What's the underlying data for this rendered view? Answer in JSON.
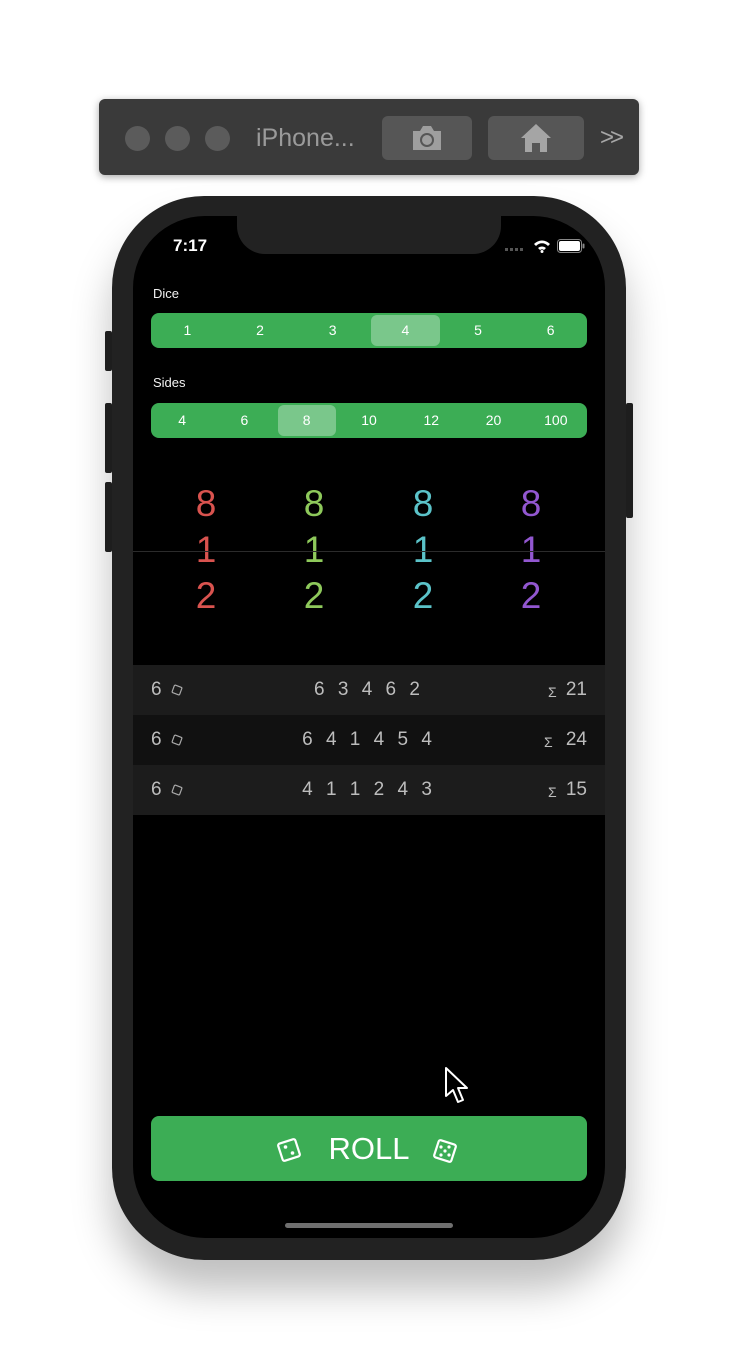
{
  "simulator": {
    "title": "iPhone...",
    "more_glyph": ">>"
  },
  "status_bar": {
    "time": "7:17"
  },
  "dice_picker": {
    "label": "Dice",
    "options": [
      "1",
      "2",
      "3",
      "4",
      "5",
      "6"
    ],
    "selected": "4"
  },
  "sides_picker": {
    "label": "Sides",
    "options": [
      "4",
      "6",
      "8",
      "10",
      "12",
      "20",
      "100"
    ],
    "selected": "8"
  },
  "dice_wheels": [
    {
      "above": "8",
      "current": "1",
      "below": "2",
      "color": "#d9534f"
    },
    {
      "above": "8",
      "current": "1",
      "below": "2",
      "color": "#8ec95b"
    },
    {
      "above": "8",
      "current": "1",
      "below": "2",
      "color": "#5bc3c9"
    },
    {
      "above": "8",
      "current": "1",
      "below": "2",
      "color": "#9257d0"
    }
  ],
  "history": [
    {
      "count": "6",
      "values": "6 3 4 6 2",
      "sigma": "Σ",
      "sum": "21"
    },
    {
      "count": "6",
      "values": "6 4 1 4 5 4",
      "sigma": "Σ",
      "sum": "24"
    },
    {
      "count": "6",
      "values": "4 1 1 2 4 3",
      "sigma": "Σ",
      "sum": "15"
    }
  ],
  "roll_button": {
    "label": "ROLL"
  },
  "colors": {
    "accent_green": "#3cad55",
    "row_light": "#1c1c1c",
    "row_dark": "#111111"
  }
}
